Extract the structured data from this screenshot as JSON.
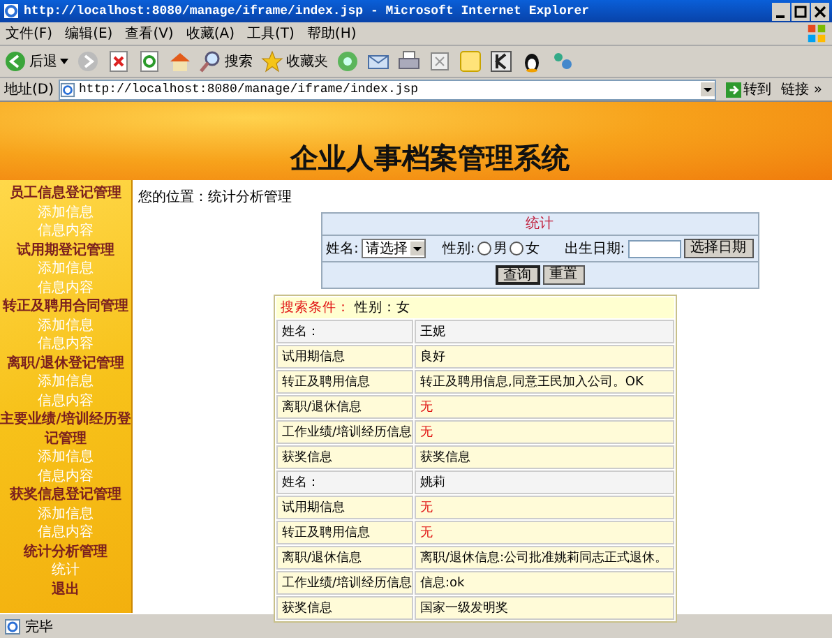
{
  "window": {
    "title": "http://localhost:8080/manage/iframe/index.jsp - Microsoft Internet Explorer"
  },
  "menu": [
    "文件(F)",
    "编辑(E)",
    "查看(V)",
    "收藏(A)",
    "工具(T)",
    "帮助(H)"
  ],
  "toolbar": {
    "back": "后退",
    "search": "搜索",
    "favorites": "收藏夹"
  },
  "address_bar": {
    "label": "地址(D)",
    "value": "http://localhost:8080/manage/iframe/index.jsp",
    "go": "转到",
    "links": "链接 »"
  },
  "banner": {
    "title": "企业人事档案管理系统"
  },
  "sidebar": [
    {
      "title": "员工信息登记管理",
      "items": [
        "添加信息",
        "信息内容"
      ]
    },
    {
      "title": "试用期登记管理",
      "items": [
        "添加信息",
        "信息内容"
      ]
    },
    {
      "title": "转正及聘用合同管理",
      "items": [
        "添加信息",
        "信息内容"
      ]
    },
    {
      "title": "离职/退休登记管理",
      "items": [
        "添加信息",
        "信息内容"
      ]
    },
    {
      "title": "主要业绩/培训经历登记管理",
      "items": [
        "添加信息",
        "信息内容"
      ]
    },
    {
      "title": "获奖信息登记管理",
      "items": [
        "添加信息",
        "信息内容"
      ]
    },
    {
      "title": "统计分析管理",
      "items": [
        "统计"
      ]
    },
    {
      "title": "退出"
    }
  ],
  "breadcrumb": "您的位置：统计分析管理",
  "search_form": {
    "title": "统计",
    "name_label": "姓名:",
    "name_select": "请选择",
    "gender_label": "性别:",
    "genders": [
      {
        "label": "男",
        "selected": false
      },
      {
        "label": "女",
        "selected": false
      }
    ],
    "birth_label": "出生日期:",
    "date_button": "选择日期",
    "query_button": "查询",
    "reset_button": "重置"
  },
  "results": {
    "condition_label": "搜索条件：",
    "condition": "性别：女",
    "rows": [
      {
        "kind": "name",
        "label": "姓名：",
        "value": "王妮",
        "missing": false
      },
      {
        "kind": "info",
        "label": "试用期信息",
        "value": "良好",
        "missing": false
      },
      {
        "kind": "info",
        "label": "转正及聘用信息",
        "value": "转正及聘用信息,同意王民加入公司。OK",
        "missing": false
      },
      {
        "kind": "info",
        "label": "离职/退休信息",
        "value": "无",
        "missing": true
      },
      {
        "kind": "info",
        "label": "工作业绩/培训经历信息",
        "value": "无",
        "missing": true
      },
      {
        "kind": "info",
        "label": "获奖信息",
        "value": "获奖信息",
        "missing": false
      },
      {
        "kind": "name",
        "label": "姓名：",
        "value": "姚莉",
        "missing": false
      },
      {
        "kind": "info",
        "label": "试用期信息",
        "value": "无",
        "missing": true
      },
      {
        "kind": "info",
        "label": "转正及聘用信息",
        "value": "无",
        "missing": true
      },
      {
        "kind": "info",
        "label": "离职/退休信息",
        "value": "离职/退休信息:公司批准姚莉同志正式退休。",
        "missing": false
      },
      {
        "kind": "info",
        "label": "工作业绩/培训经历信息",
        "value": "信息:ok",
        "missing": false
      },
      {
        "kind": "info",
        "label": "获奖信息",
        "value": "国家一级发明奖",
        "missing": false
      }
    ]
  },
  "status_bar": {
    "text": "完毕"
  }
}
